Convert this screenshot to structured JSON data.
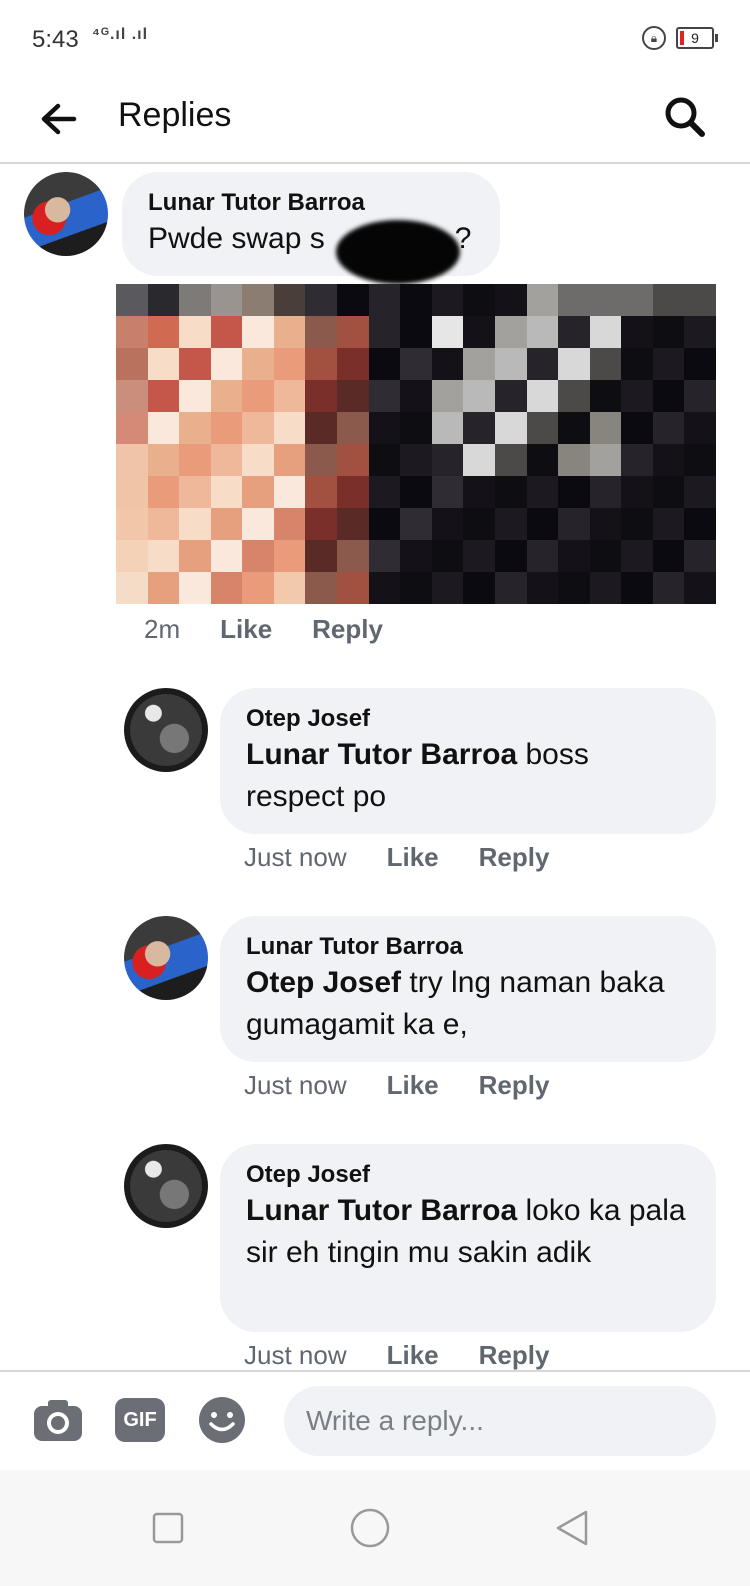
{
  "status_bar": {
    "time": "5:43",
    "signal": "⁴ᴳ.ıl .ıl",
    "battery": "9"
  },
  "header": {
    "title": "Replies"
  },
  "comments": [
    {
      "author": "Lunar Tutor Barroa",
      "mention": "",
      "text": "Pwde swap s",
      "text_tail": "?",
      "time": "2m",
      "like": "Like",
      "reply": "Reply"
    },
    {
      "author": "Otep Josef",
      "mention": "Lunar Tutor Barroa",
      "text": " boss respect po",
      "time": "Just now",
      "like": "Like",
      "reply": "Reply"
    },
    {
      "author": "Lunar Tutor Barroa",
      "mention": "Otep Josef",
      "text": " try lng naman baka gumagamit ka e,",
      "time": "Just now",
      "like": "Like",
      "reply": "Reply"
    },
    {
      "author": "Otep Josef",
      "mention": "Lunar Tutor Barroa",
      "text": " loko ka pala sir eh tingin mu sakin adik",
      "time": "Just now",
      "like": "Like",
      "reply": "Reply"
    }
  ],
  "composer": {
    "placeholder": "Write a reply...",
    "gif_label": "GIF"
  },
  "colors": {
    "bubble": "#f0f2f5",
    "meta": "#606770"
  }
}
